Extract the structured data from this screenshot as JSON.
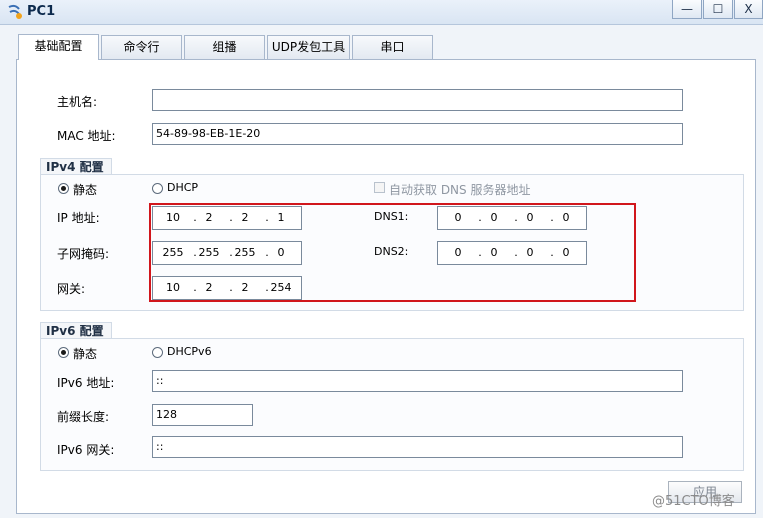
{
  "window": {
    "title": "PC1",
    "minimize": "—",
    "maximize": "☐",
    "close": "X"
  },
  "tabs": [
    {
      "label": "基础配置"
    },
    {
      "label": "命令行"
    },
    {
      "label": "组播"
    },
    {
      "label": "UDP发包工具"
    },
    {
      "label": "串口"
    }
  ],
  "basic": {
    "hostname_label": "主机名:",
    "hostname_value": "",
    "mac_label": "MAC 地址:",
    "mac_value": "54-89-98-EB-1E-20"
  },
  "ipv4": {
    "group_title": "IPv4 配置",
    "static_label": "静态",
    "dhcp_label": "DHCP",
    "auto_dns_label": "自动获取 DNS 服务器地址",
    "ip_label": "IP 地址:",
    "ip": [
      "10",
      "2",
      "2",
      "1"
    ],
    "mask_label": "子网掩码:",
    "mask": [
      "255",
      "255",
      "255",
      "0"
    ],
    "gateway_label": "网关:",
    "gateway": [
      "10",
      "2",
      "2",
      "254"
    ],
    "dns1_label": "DNS1:",
    "dns1": [
      "0",
      "0",
      "0",
      "0"
    ],
    "dns2_label": "DNS2:",
    "dns2": [
      "0",
      "0",
      "0",
      "0"
    ],
    "dot": "."
  },
  "ipv6": {
    "group_title": "IPv6 配置",
    "static_label": "静态",
    "dhcp_label": "DHCPv6",
    "ip_label": "IPv6 地址:",
    "ip_value": "::",
    "prefix_label": "前缀长度:",
    "prefix_value": "128",
    "gateway_label": "IPv6 网关:",
    "gateway_value": "::"
  },
  "apply_label": "应用",
  "watermark": "@51CTO博客",
  "colors": {
    "highlight": "#d1161c",
    "panel_bg": "#ffffff",
    "title_text": "#0d2a4d"
  },
  "icons": {
    "app": "network-pc-icon"
  }
}
